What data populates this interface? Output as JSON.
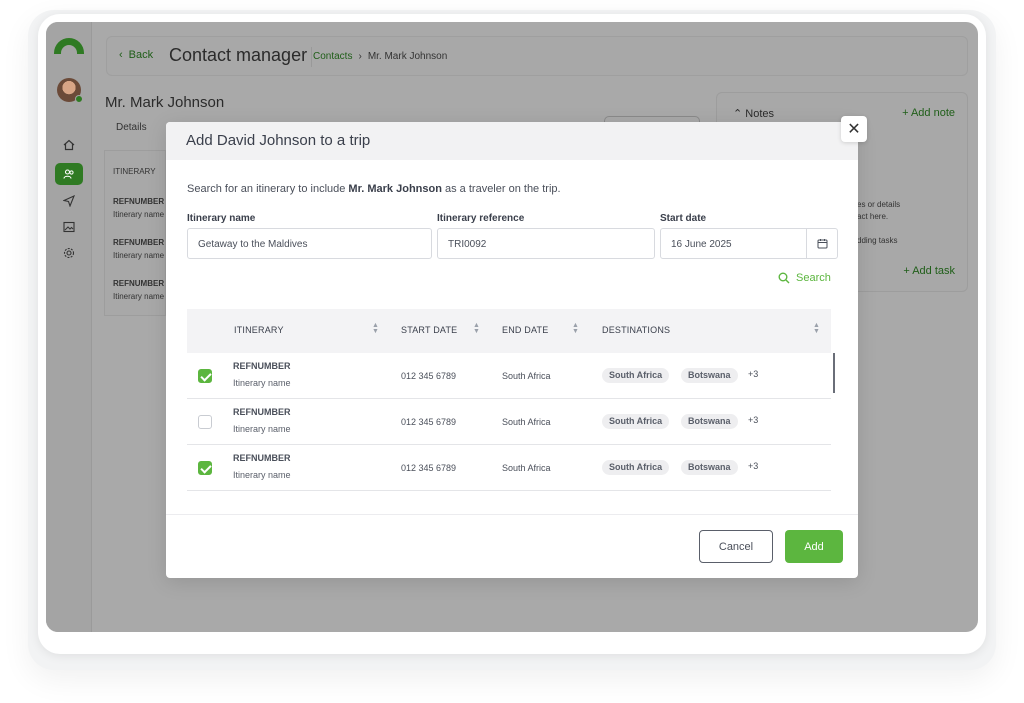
{
  "header": {
    "back_label": "Back",
    "title": "Contact manager",
    "breadcrumb": [
      "Contacts",
      "Mr. Mark Johnson"
    ]
  },
  "background": {
    "contact_name": "Mr. Mark Johnson",
    "tab_details": "Details",
    "panel_header": "ITINERARY",
    "rows": [
      {
        "ref": "REFNUMBER",
        "name": "Itinerary name"
      },
      {
        "ref": "REFNUMBER",
        "name": "Itinerary name"
      },
      {
        "ref": "REFNUMBER",
        "name": "Itinerary name"
      }
    ],
    "notes": {
      "title": "Notes",
      "add_note": "Add note",
      "text_line1": "es or details",
      "text_line2": "act here.",
      "text_line3": "dding tasks",
      "add_task": "Add task"
    }
  },
  "modal": {
    "title": "Add David Johnson to a trip",
    "intro_prefix": "Search for an itinerary to include ",
    "intro_name": "Mr. Mark Johnson",
    "intro_suffix": " as a traveler on the trip.",
    "fields": {
      "itinerary_name_label": "Itinerary name",
      "itinerary_name_value": "Getaway to the Maldives",
      "itinerary_ref_label": "Itinerary reference",
      "itinerary_ref_value": "TRI0092",
      "start_date_label": "Start date",
      "start_date_value": "16 June 2025"
    },
    "search_label": "Search",
    "columns": [
      "ITINERARY",
      "START DATE",
      "END DATE",
      "DESTINATIONS"
    ],
    "rows": [
      {
        "checked": true,
        "ref": "REFNUMBER",
        "name": "Itinerary name",
        "start": "012 345 6789",
        "end": "South Africa",
        "dest1": "South Africa",
        "dest2": "Botswana",
        "more": "+3"
      },
      {
        "checked": false,
        "ref": "REFNUMBER",
        "name": "Itinerary name",
        "start": "012 345 6789",
        "end": "South Africa",
        "dest1": "South Africa",
        "dest2": "Botswana",
        "more": "+3"
      },
      {
        "checked": true,
        "ref": "REFNUMBER",
        "name": "Itinerary name",
        "start": "012 345 6789",
        "end": "South Africa",
        "dest1": "South Africa",
        "dest2": "Botswana",
        "more": "+3"
      }
    ],
    "cancel_label": "Cancel",
    "add_label": "Add"
  },
  "icons": {
    "close": "close-icon",
    "search": "search-icon",
    "calendar": "calendar-icon",
    "sort": "sort-icon",
    "home": "home-icon",
    "contacts": "contacts-icon",
    "send": "send-icon",
    "image": "image-icon",
    "settings": "gear-icon"
  },
  "colors": {
    "accent": "#5cb63f",
    "overlay": "#a9a9a9"
  }
}
